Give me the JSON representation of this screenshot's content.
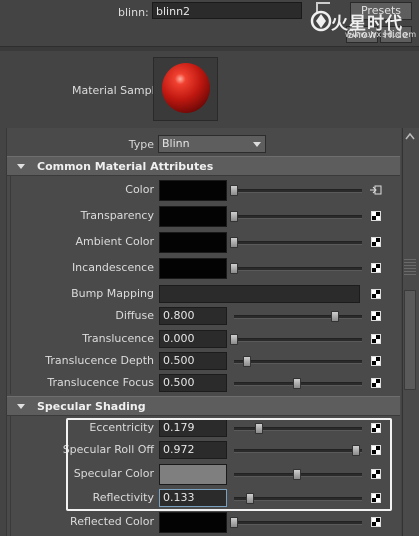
{
  "header": {
    "name_label": "blinn:",
    "name_value": "blinn2",
    "presets_label": "Presets",
    "show_label": "Show",
    "hide_label": "Hide",
    "watermark_text": "火星时代",
    "watermark_sub": "www.hxsd.com"
  },
  "swatch": {
    "label": "Material Sample",
    "color": "#c01810"
  },
  "type": {
    "label": "Type",
    "value": "Blinn"
  },
  "sections": {
    "common": "Common Material Attributes",
    "specular": "Specular Shading"
  },
  "common_rows": [
    {
      "label": "Color",
      "kind": "color",
      "swatch_color": "#030303",
      "slider_pos": 0.0,
      "icon": "map-arrow-icon"
    },
    {
      "label": "Transparency",
      "kind": "color",
      "swatch_color": "#030303",
      "slider_pos": 0.0,
      "icon": "checker-icon"
    },
    {
      "label": "Ambient Color",
      "kind": "color",
      "swatch_color": "#030303",
      "slider_pos": 0.0,
      "icon": "checker-icon"
    },
    {
      "label": "Incandescence",
      "kind": "color",
      "swatch_color": "#030303",
      "slider_pos": 0.0,
      "icon": "checker-icon"
    },
    {
      "label": "Bump Mapping",
      "kind": "map",
      "icon": "checker-icon"
    },
    {
      "label": "Diffuse",
      "kind": "number",
      "value": "0.800",
      "slider_pos": 0.8,
      "icon": "checker-icon"
    },
    {
      "label": "Translucence",
      "kind": "number",
      "value": "0.000",
      "slider_pos": 0.0,
      "icon": "checker-icon"
    },
    {
      "label": "Translucence Depth",
      "kind": "number",
      "value": "0.500",
      "slider_pos": 0.1,
      "icon": "checker-icon"
    },
    {
      "label": "Translucence Focus",
      "kind": "number",
      "value": "0.500",
      "slider_pos": 0.5,
      "icon": "checker-icon"
    }
  ],
  "specular_rows": [
    {
      "label": "Eccentricity",
      "kind": "number",
      "value": "0.179",
      "slider_pos": 0.2,
      "icon": "checker-icon"
    },
    {
      "label": "Specular Roll Off",
      "kind": "number",
      "value": "0.972",
      "slider_pos": 0.97,
      "icon": "checker-icon"
    },
    {
      "label": "Specular Color",
      "kind": "color",
      "swatch_color": "#7f7f7f",
      "slider_pos": 0.5,
      "icon": "checker-icon"
    },
    {
      "label": "Reflectivity",
      "kind": "number",
      "value": "0.133",
      "slider_pos": 0.13,
      "active": true,
      "icon": "checker-icon"
    },
    {
      "label": "Reflected Color",
      "kind": "color",
      "swatch_color": "#030303",
      "slider_pos": 0.0,
      "icon": "checker-icon"
    }
  ]
}
